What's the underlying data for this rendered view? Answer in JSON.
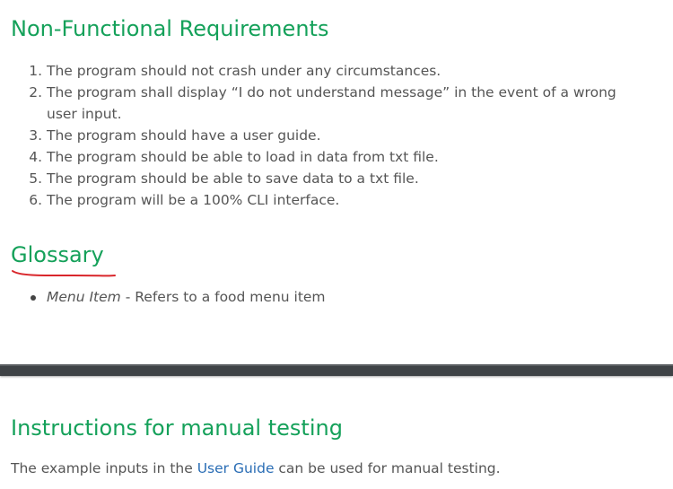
{
  "nfr": {
    "heading": "Non-Functional Requirements",
    "items": [
      "The program should not crash under any circumstances.",
      "The program shall display “I do not understand message” in the event of a wrong user input.",
      "The program should have a user guide.",
      "The program should be able to load in data from txt file.",
      "The program should be able to save data to a txt file.",
      "The program will be a 100% CLI interface."
    ]
  },
  "glossary": {
    "heading": "Glossary",
    "entries": [
      {
        "term": "Menu Item",
        "definition": " - Refers to a food menu item"
      }
    ]
  },
  "manual_testing": {
    "heading": "Instructions for manual testing",
    "text_before": "The example inputs in the ",
    "link_label": "User Guide",
    "text_after": " can be used for manual testing."
  },
  "colors": {
    "heading": "#15a15a",
    "body_text": "#555555",
    "link": "#2a6db5",
    "annotation": "#d9262b",
    "divider": "#3f4346"
  }
}
